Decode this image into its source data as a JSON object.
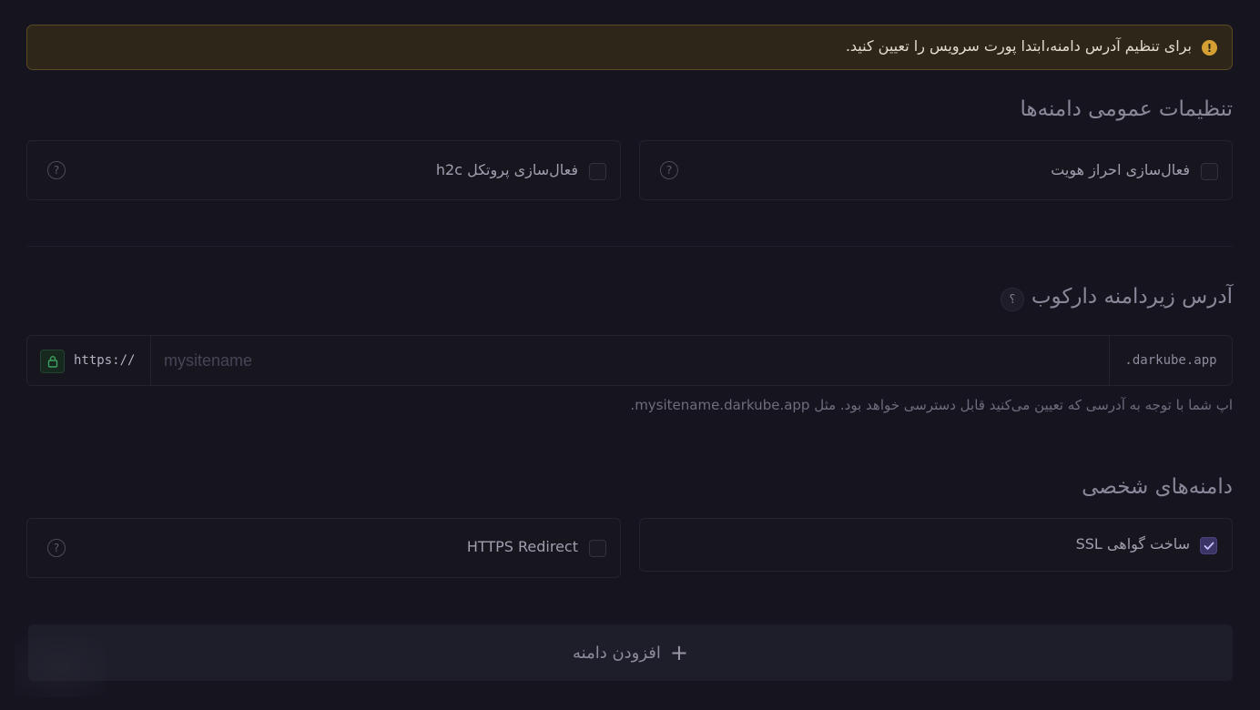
{
  "alert": {
    "text": "برای تنظیم آدرس دامنه،ابتدا پورت سرویس را تعیین کنید.",
    "icon": "!"
  },
  "general": {
    "title": "تنظیمات عمومی دامنه‌ها",
    "auth_label": "فعال‌سازی احراز هویت",
    "h2c_label": "فعال‌سازی پروتکل h2c"
  },
  "subdomain": {
    "title": "آدرس زیردامنه دارکوب",
    "help": "؟",
    "prefix": "https://",
    "suffix": ".darkube.app",
    "placeholder": "mysitename",
    "hint": "اپ شما با توجه به آدرسی که تعیین می‌کنید قابل دسترسی خواهد بود. مثل mysitename.darkube.app."
  },
  "custom": {
    "title": "دامنه‌های شخصی",
    "ssl_label": "ساخت گواهی SSL",
    "ssl_checked": true,
    "https_label": "HTTPS Redirect",
    "add_label": "افزودن دامنه",
    "add_icon": "+"
  },
  "help_glyph": "?",
  "colors": {
    "background": "#15141f",
    "alert_bg": "#2e2619",
    "alert_icon": "#d4a033",
    "checkbox_checked": "#3b3566",
    "lock": "#3ea05e"
  }
}
